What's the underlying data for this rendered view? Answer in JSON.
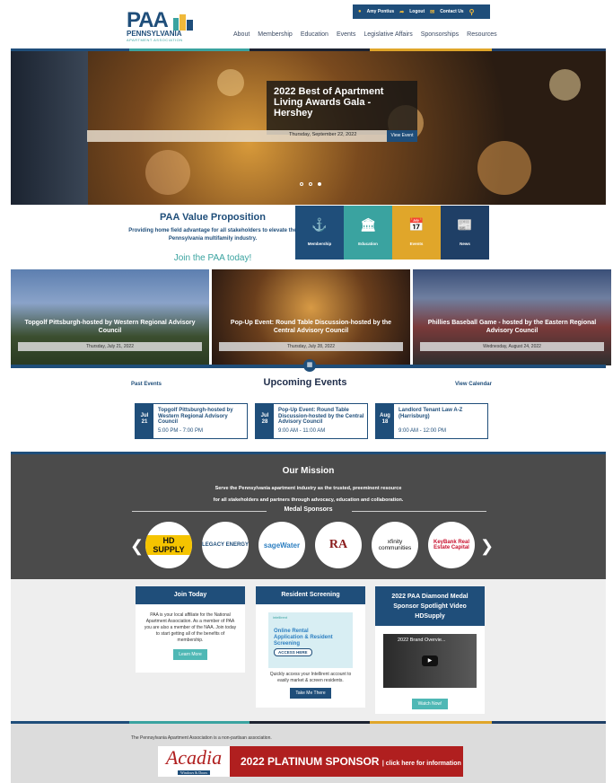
{
  "topbar": {
    "user": "Amy Pontius",
    "logout": "Logout",
    "contact": "Contact Us"
  },
  "logo": {
    "paa": "PAA",
    "penn": "PENNSYLVANIA",
    "assoc": "APARTMENT ASSOCIATION"
  },
  "nav": [
    "About",
    "Membership",
    "Education",
    "Events",
    "Legislative Affairs",
    "Sponsorships",
    "Resources"
  ],
  "hero": {
    "title": "2022 Best of Apartment Living Awards Gala - Hershey",
    "date": "Thursday, September 22, 2022",
    "button": "View Event",
    "slides_total": 3,
    "active_slide": 3
  },
  "value_prop": {
    "title": "PAA Value Proposition",
    "text": "Providing home field advantage for all stakeholders to elevate the Pennsylvania multifamily industry.",
    "join": "Join the PAA today!",
    "tiles": [
      {
        "label": "Membership",
        "icon": "handshake-icon",
        "color": "#1f4e7a"
      },
      {
        "label": "Education",
        "icon": "institution-icon",
        "color": "#3aa3a0"
      },
      {
        "label": "Events",
        "icon": "calendar-icon",
        "color": "#e0a62a"
      },
      {
        "label": "News",
        "icon": "newspaper-icon",
        "color": "#1f3f66"
      }
    ]
  },
  "event_cards": [
    {
      "title": "Topgolf Pittsburgh-hosted by Western Regional Advisory Council",
      "date": "Thursday, July 21, 2022"
    },
    {
      "title": "Pop-Up Event: Round Table Discussion-hosted by the Central Advisory Council",
      "date": "Thursday, July 28, 2022"
    },
    {
      "title": "Phillies Baseball Game - hosted by the Eastern Regional Advisory Council",
      "date": "Wednesday, August 24, 2022"
    }
  ],
  "upcoming": {
    "past": "Past Events",
    "title": "Upcoming Events",
    "view_calendar": "View Calendar",
    "events": [
      {
        "month": "Jul",
        "day": "21",
        "title": "Topgolf Pittsburgh-hosted by Western Regional Advisory Council",
        "time": "5:00 PM - 7:00 PM"
      },
      {
        "month": "Jul",
        "day": "28",
        "title": "Pop-Up Event: Round Table Discussion-hosted by the Central Advisory Council",
        "time": "9:00 AM - 11:00 AM"
      },
      {
        "month": "Aug",
        "day": "18",
        "title": "Landlord Tenant Law A-Z (Harrisburg)",
        "time": "9:00 AM - 12:00 PM"
      }
    ]
  },
  "mission": {
    "title": "Our Mission",
    "line1": "Serve the Pennsylvania apartment industry as the trusted, preeminent resource",
    "line2": "for all stakeholders and partners through advocacy, education and collaboration.",
    "medal": "Medal Sponsors",
    "sponsors": [
      "HD SUPPLY",
      "LEGACY ENERGY",
      "sageWater",
      "RA",
      "xfinity communities",
      "KeyBank Real Estate Capital"
    ]
  },
  "boxes": {
    "join": {
      "title": "Join Today",
      "text": "PAA is your local affiliate for the National Apartment Association. As a member of PAA you are also a member of the NAA. Join today to start getting all of the benefits of membership.",
      "button": "Learn More"
    },
    "screening": {
      "title": "Resident Screening",
      "brand": "intellirent",
      "headline": "Online Rental Application & Resident Screening",
      "access": "ACCESS HERE",
      "text": "Quickly access your Intellirent account to easily market & screen residents.",
      "button": "Take Me There"
    },
    "video": {
      "title": "2022 PAA Diamond Medal Sponsor Spotlight Video HDSupply",
      "video_title": "2022 Brand Overvie...",
      "button": "Watch Now!"
    }
  },
  "footer": {
    "nonpartisan": "The Pennsylvania Apartment Association is a non-partisan association.",
    "ad_brand": "Acadia",
    "ad_sub": "Windows & Doors",
    "ad_text": "2022 PLATINUM SPONSOR",
    "ad_link": "click here for information"
  }
}
